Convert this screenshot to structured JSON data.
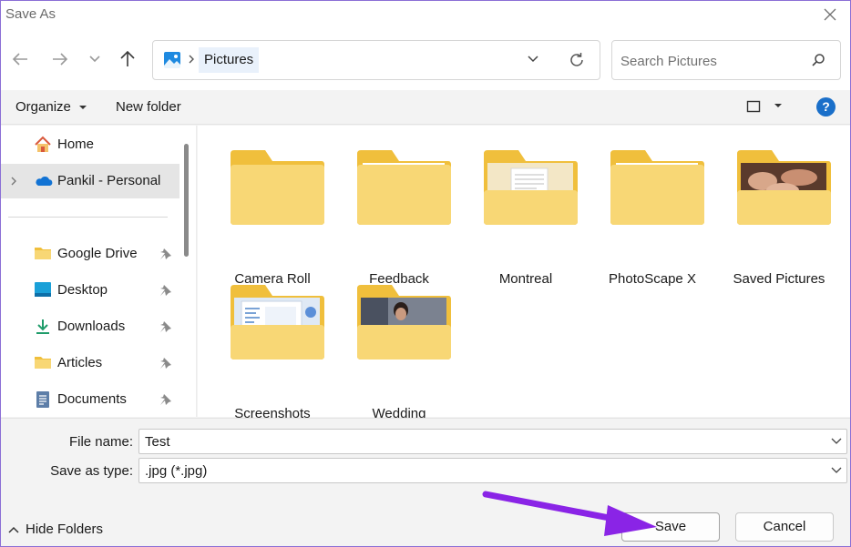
{
  "window": {
    "title": "Save As"
  },
  "address": {
    "location": "Pictures"
  },
  "search": {
    "placeholder": "Search Pictures"
  },
  "commands": {
    "organize": "Organize",
    "new_folder": "New folder",
    "help": "?"
  },
  "sidebar": {
    "items": [
      {
        "label": "Home",
        "icon": "home-icon"
      },
      {
        "label": "Pankil - Personal",
        "icon": "onedrive-cloud-icon"
      },
      {
        "label": "Google Drive",
        "icon": "folder-icon"
      },
      {
        "label": "Desktop",
        "icon": "desktop-icon"
      },
      {
        "label": "Downloads",
        "icon": "download-arrow-icon"
      },
      {
        "label": "Articles",
        "icon": "folder-icon"
      },
      {
        "label": "Documents",
        "icon": "document-icon"
      }
    ]
  },
  "folders": [
    {
      "name": "Camera Roll"
    },
    {
      "name": "Feedback"
    },
    {
      "name": "Montreal"
    },
    {
      "name": "PhotoScape X"
    },
    {
      "name": "Saved Pictures"
    },
    {
      "name": "Screenshots"
    },
    {
      "name": "Wedding"
    }
  ],
  "form": {
    "file_name_label": "File name:",
    "file_name_value": "Test",
    "save_type_label": "Save as type:",
    "save_type_value": ".jpg (*.jpg)"
  },
  "footer": {
    "hide_folders": "Hide Folders",
    "save": "Save",
    "cancel": "Cancel"
  },
  "colors": {
    "folder": "#f8d775",
    "folder_dark": "#f0bf3c",
    "accent": "#1a6fc9",
    "annotation_arrow": "#8a24e6"
  }
}
